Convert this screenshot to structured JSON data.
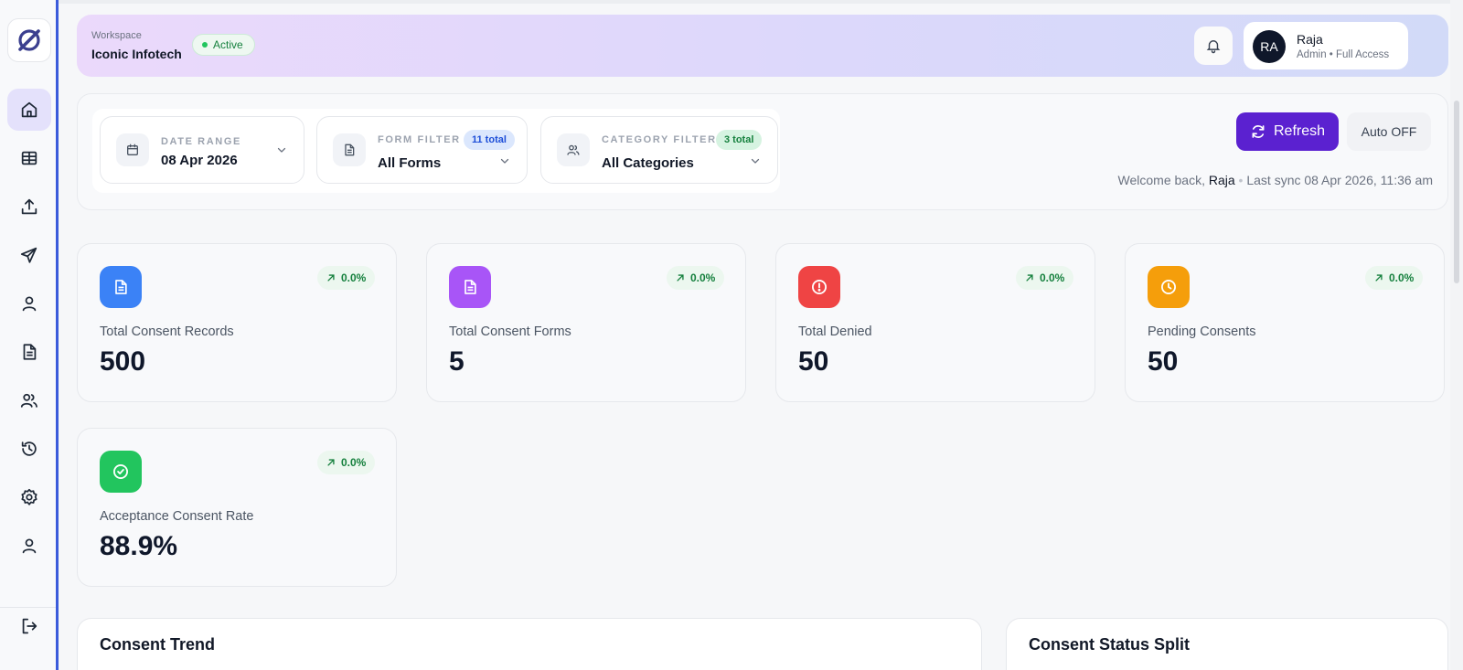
{
  "header": {
    "workspace_label": "Workspace",
    "workspace_name": "Iconic Infotech",
    "status": "Active",
    "user": {
      "initials": "RA",
      "name": "Raja",
      "role": "Admin • Full Access"
    }
  },
  "filters": [
    {
      "label": "DATE RANGE",
      "value": "08 Apr 2026",
      "badge": ""
    },
    {
      "label": "FORM FILTER",
      "value": "All Forms",
      "badge": "11 total"
    },
    {
      "label": "CATEGORY FILTER",
      "value": "All Categories",
      "badge": "3 total"
    }
  ],
  "actions": {
    "refresh": "Refresh",
    "auto": "Auto OFF"
  },
  "welcome": {
    "prefix": "Welcome back,",
    "name": "Raja",
    "sync": "Last sync 08 Apr 2026, 11:36 am"
  },
  "stats": [
    {
      "label": "Total Consent Records",
      "value": "500",
      "trend": "0.0%",
      "color": "#3b82f6",
      "icon": "document-icon"
    },
    {
      "label": "Total Consent Forms",
      "value": "5",
      "trend": "0.0%",
      "color": "#a855f7",
      "icon": "document-icon"
    },
    {
      "label": "Total Denied",
      "value": "50",
      "trend": "0.0%",
      "color": "#ef4444",
      "icon": "alert-icon"
    },
    {
      "label": "Pending Consents",
      "value": "50",
      "trend": "0.0%",
      "color": "#f59e0b",
      "icon": "clock-icon"
    },
    {
      "label": "Acceptance Consent Rate",
      "value": "88.9%",
      "trend": "0.0%",
      "color": "#22c55e",
      "icon": "check-circle-icon"
    }
  ],
  "panels": {
    "trend_title": "Consent Trend",
    "split_title": "Consent Status Split"
  },
  "sidebar": {
    "items": [
      "home-icon",
      "table-icon",
      "upload-icon",
      "send-icon",
      "user-icon",
      "document-icon",
      "users-icon",
      "history-icon",
      "settings-icon",
      "profile-icon"
    ],
    "logout": "logout-icon"
  },
  "colors": {
    "accent": "#5b21d0",
    "sidebar_border": "#3b5bdb",
    "success": "#15803d"
  }
}
